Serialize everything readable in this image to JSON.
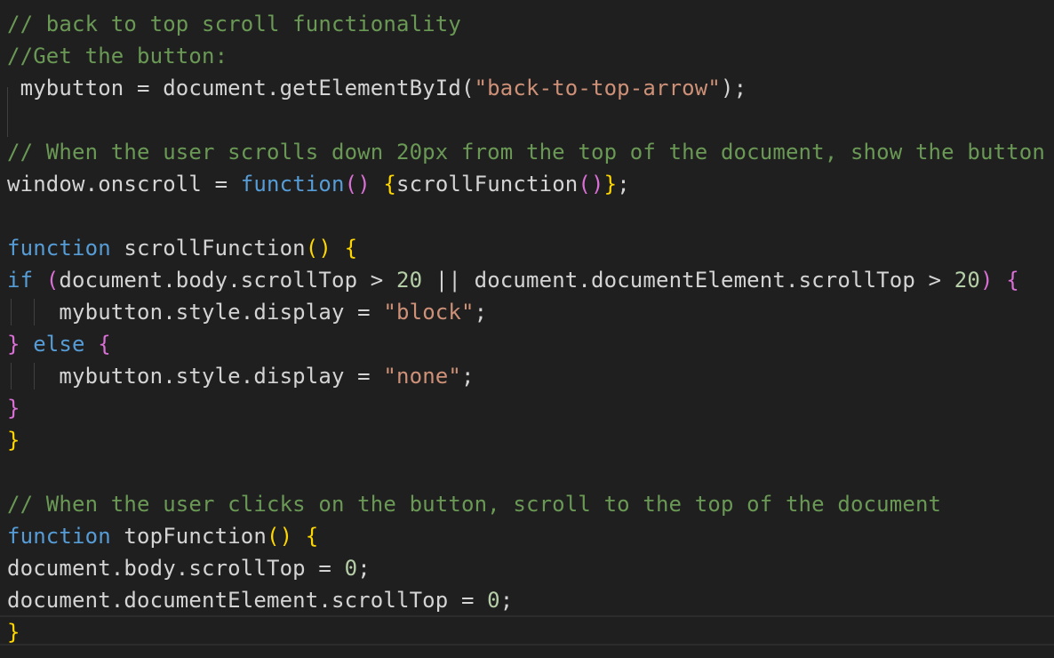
{
  "editor": {
    "colors": {
      "background": "#1f1f1f",
      "default": "#d4d4d4",
      "comment": "#6a9955",
      "keyword_blue": "#569cd6",
      "keyword_purple": "#c586c0",
      "function": "#dcdcaa",
      "variable": "#9cdcfe",
      "string": "#ce9178",
      "number": "#b5cea8",
      "bracket_gold": "#ffd700",
      "bracket_violet": "#da70d6",
      "bracket_blue": "#179fff"
    },
    "lines": [
      [
        {
          "text": "// back to top scroll functionality",
          "c": "comment"
        }
      ],
      [
        {
          "text": "//Get the button:",
          "c": "comment"
        }
      ],
      [
        {
          "text": " mybutton = document.getElementById(",
          "c": "default"
        },
        {
          "text": "\"back-to-top-arrow\"",
          "c": "string"
        },
        {
          "text": ");",
          "c": "default"
        }
      ],
      [],
      [
        {
          "text": "// When the user scrolls down 20px from the top of the document, show the button",
          "c": "comment"
        }
      ],
      [
        {
          "text": "window.onscroll = ",
          "c": "default"
        },
        {
          "text": "function",
          "c": "keyword_blue"
        },
        {
          "text": "() ",
          "c": "bracket_violet"
        },
        {
          "text": "{",
          "c": "bracket_gold"
        },
        {
          "text": "scrollFunction",
          "c": "default"
        },
        {
          "text": "()",
          "c": "bracket_violet"
        },
        {
          "text": "}",
          "c": "bracket_gold"
        },
        {
          "text": ";",
          "c": "default"
        }
      ],
      [],
      [
        {
          "text": "function",
          "c": "keyword_blue"
        },
        {
          "text": " scrollFunction",
          "c": "default"
        },
        {
          "text": "() {",
          "c": "bracket_gold"
        }
      ],
      [
        {
          "text": "if",
          "c": "keyword_blue"
        },
        {
          "text": " (",
          "c": "bracket_violet"
        },
        {
          "text": "document.body.scrollTop > ",
          "c": "default"
        },
        {
          "text": "20",
          "c": "number"
        },
        {
          "text": " || document.documentElement.scrollTop > ",
          "c": "default"
        },
        {
          "text": "20",
          "c": "number"
        },
        {
          "text": ")",
          "c": "bracket_violet"
        },
        {
          "text": " {",
          "c": "bracket_violet"
        }
      ],
      [
        {
          "text": "    mybutton.style.display = ",
          "c": "default"
        },
        {
          "text": "\"block\"",
          "c": "string"
        },
        {
          "text": ";",
          "c": "default"
        }
      ],
      [
        {
          "text": "}",
          "c": "bracket_violet"
        },
        {
          "text": " else ",
          "c": "keyword_blue"
        },
        {
          "text": "{",
          "c": "bracket_violet"
        }
      ],
      [
        {
          "text": "    mybutton.style.display = ",
          "c": "default"
        },
        {
          "text": "\"none\"",
          "c": "string"
        },
        {
          "text": ";",
          "c": "default"
        }
      ],
      [
        {
          "text": "}",
          "c": "bracket_violet"
        }
      ],
      [
        {
          "text": "}",
          "c": "bracket_gold"
        }
      ],
      [],
      [
        {
          "text": "// When the user clicks on the button, scroll to the top of the document",
          "c": "comment"
        }
      ],
      [
        {
          "text": "function",
          "c": "keyword_blue"
        },
        {
          "text": " topFunction",
          "c": "default"
        },
        {
          "text": "() {",
          "c": "bracket_gold"
        }
      ],
      [
        {
          "text": "document.body.scrollTop = ",
          "c": "default"
        },
        {
          "text": "0",
          "c": "number"
        },
        {
          "text": ";",
          "c": "default"
        }
      ],
      [
        {
          "text": "document.documentElement.scrollTop = ",
          "c": "default"
        },
        {
          "text": "0",
          "c": "number"
        },
        {
          "text": ";",
          "c": "default"
        }
      ],
      [
        {
          "text": "}",
          "c": "bracket_gold"
        }
      ]
    ]
  }
}
